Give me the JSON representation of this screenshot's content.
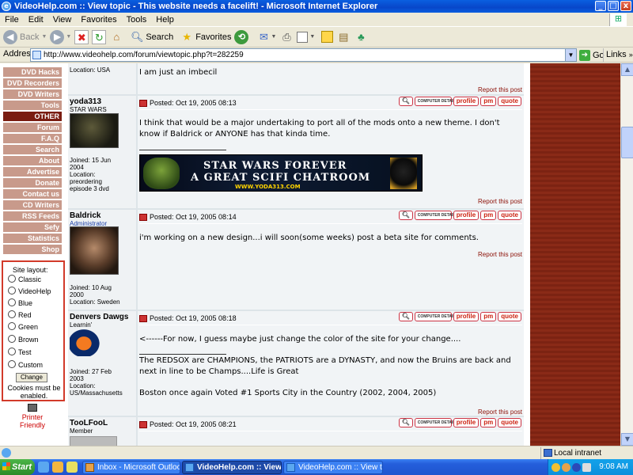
{
  "window": {
    "title": "VideoHelp.com :: View topic - This website needs a facelift! - Microsoft Internet Explorer",
    "minimize": "_",
    "maximize": "□",
    "close": "x"
  },
  "menu": [
    "File",
    "Edit",
    "View",
    "Favorites",
    "Tools",
    "Help"
  ],
  "toolbar": {
    "back": "Back",
    "search": "Search",
    "favorites": "Favorites"
  },
  "address": {
    "label": "Address",
    "url": "http://www.videohelp.com/forum/viewtopic.php?t=282259",
    "go": "Go",
    "links": "Links"
  },
  "nav": {
    "items": [
      "DVD Hacks",
      "DVD Recorders",
      "DVD Writers",
      "Tools",
      "OTHER",
      "Forum",
      "F.A.Q",
      "Search",
      "About",
      "Advertise",
      "Donate",
      "Contact us",
      "CD Writers",
      "RSS Feeds",
      "Sefy",
      "Statistics",
      "Shop"
    ]
  },
  "site_layout": {
    "header": "Site layout:",
    "options": [
      "Classic",
      "VideoHelp",
      "Blue",
      "Red",
      "Green",
      "Brown",
      "Test",
      "Custom"
    ],
    "change_button": "Change",
    "cookie_note": "Cookies must be enabled."
  },
  "printer_friendly": "Printer Friendly",
  "posts": [
    {
      "location": "Location: USA",
      "body": [
        "I am just an imbecil"
      ],
      "report": "Report this post"
    },
    {
      "username": "yoda313",
      "rank": "STAR WARS",
      "posted": "Posted: Oct 19, 2005 08:13",
      "joined": [
        "Joined: 15 Jun",
        "2004",
        "Location:",
        "preordering",
        "episode 3 dvd"
      ],
      "body": [
        "I think that would be a major undertaking to port all of the mods onto a new theme. I don't know if Baldrick or ANYONE has that kinda time."
      ],
      "banner": [
        "STAR WARS FOREVER",
        "A GREAT SCIFI CHATROOM",
        "WWW.YODA313.COM"
      ],
      "report": "Report this post"
    },
    {
      "username": "Baldrick",
      "rank": "Administrator",
      "posted": "Posted: Oct 19, 2005 08:14",
      "joined": [
        "Joined: 10 Aug",
        "2000",
        "Location: Sweden"
      ],
      "body": [
        "i'm working on a new design...i will soon(some weeks) post a beta site for comments."
      ],
      "report": "Report this post"
    },
    {
      "username": "Denvers Dawgs",
      "rank": "Learnin'",
      "posted": "Posted: Oct 19, 2005 08:18",
      "joined": [
        "Joined: 27 Feb",
        "2003",
        "Location:",
        "US/Massachusetts"
      ],
      "body": [
        "<------For now, I guess maybe just change the color of the site for your change....",
        "The REDSOX are CHAMPIONS, the PATRIOTS are a DYNASTY, and now the Bruins are back and next in line to be Champs....Life is Great",
        "Boston once again Voted #1 Sports City in the Country (2002, 2004, 2005)"
      ],
      "report": "Report this post"
    },
    {
      "username": "TooLFooL",
      "rank": "Member",
      "posted": "Posted: Oct 19, 2005 08:21"
    }
  ],
  "post_buttons": {
    "details": "COMPUTER DETAILS",
    "profile": "profile",
    "pm": "pm",
    "quote": "quote"
  },
  "status": {
    "zone": "Local intranet"
  },
  "taskbar": {
    "start": "Start",
    "tasks": [
      "Inbox - Microsoft Outlook",
      "VideoHelp.com :: View...",
      "VideoHelp.com :: View to..."
    ],
    "clock": "9:08 AM"
  },
  "colors": {
    "nav_bg": "#c89a8b",
    "nav_active": "#7a1d12",
    "accent_red": "#d23a2a",
    "post_bg": "#f1f4f6"
  }
}
